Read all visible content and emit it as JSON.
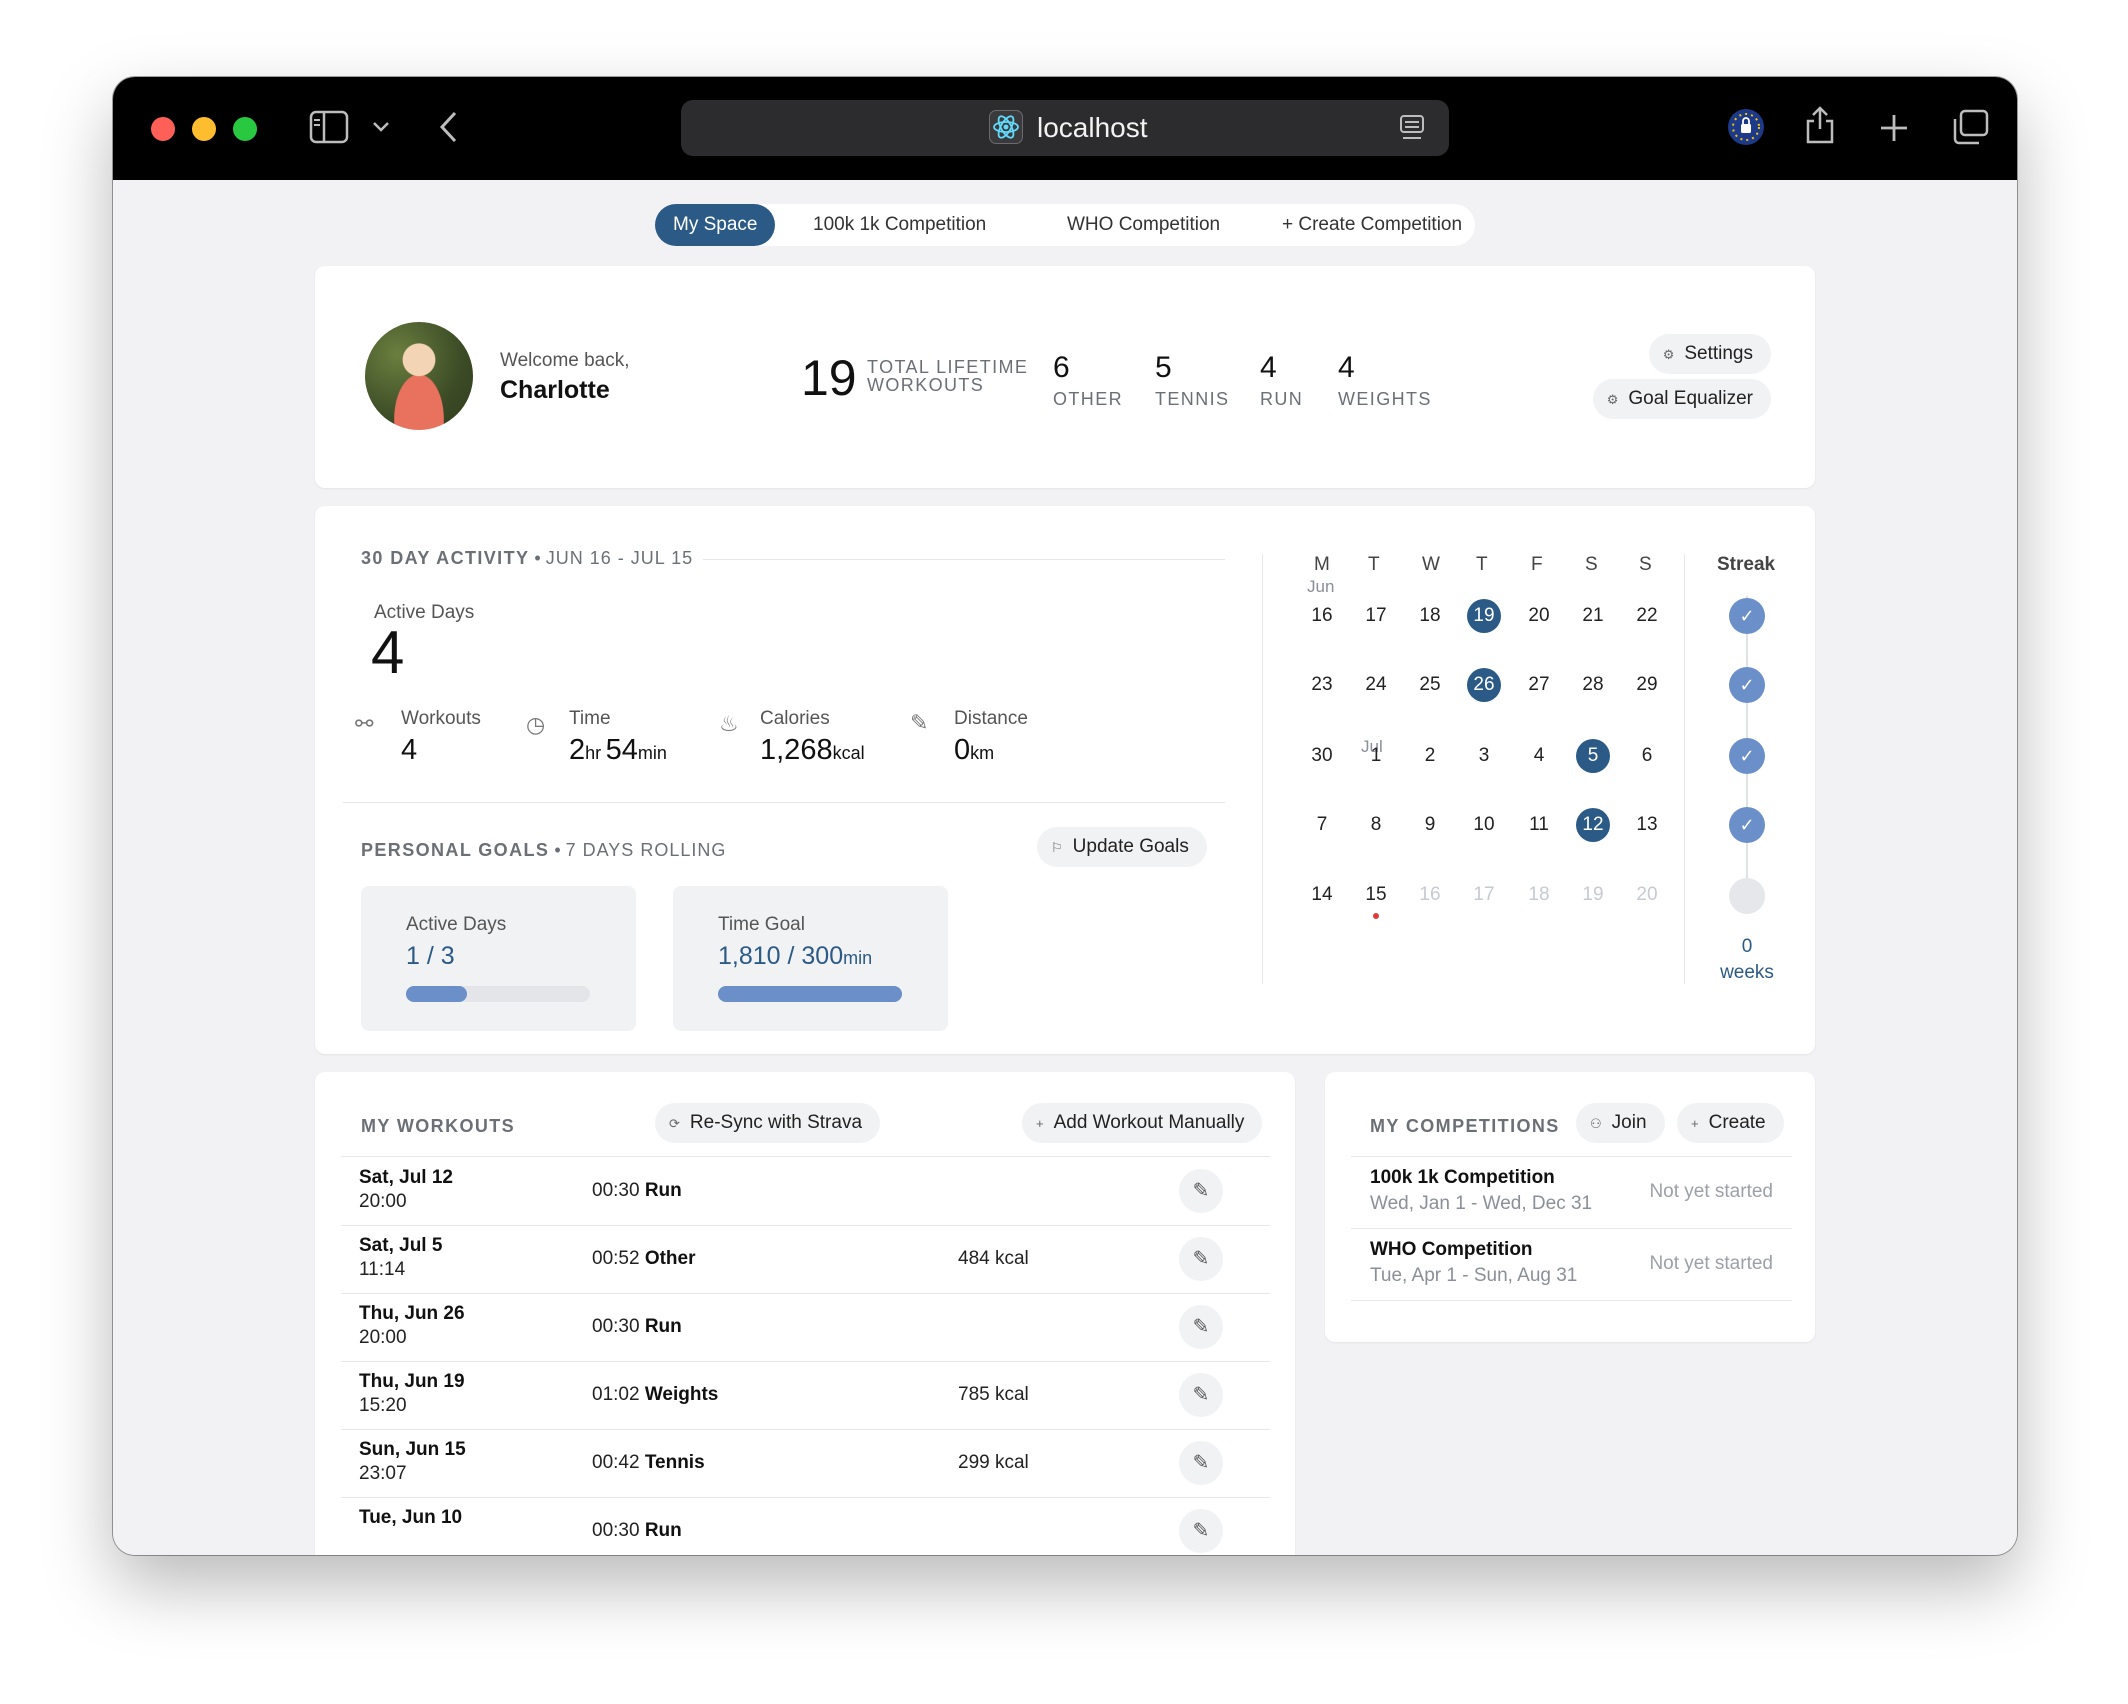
{
  "browser": {
    "url": "localhost"
  },
  "tabs": [
    {
      "label": "My Space",
      "active": true
    },
    {
      "label": "100k 1k Competition",
      "active": false
    },
    {
      "label": "WHO Competition",
      "active": false
    },
    {
      "label": "+ Create Competition",
      "active": false
    }
  ],
  "profile": {
    "welcome": "Welcome back,",
    "name": "Charlotte",
    "total_count": "19",
    "total_label_line1": "TOTAL LIFETIME",
    "total_label_line2": "WORKOUTS",
    "stats": [
      {
        "value": "6",
        "label": "OTHER"
      },
      {
        "value": "5",
        "label": "TENNIS"
      },
      {
        "value": "4",
        "label": "RUN"
      },
      {
        "value": "4",
        "label": "WEIGHTS"
      }
    ],
    "settings_label": "Settings",
    "goal_equalizer_label": "Goal Equalizer"
  },
  "activity": {
    "title": "30 DAY ACTIVITY",
    "range": "JUN 16 - JUL 15",
    "active_days_label": "Active Days",
    "active_days_value": "4",
    "metrics": {
      "workouts_label": "Workouts",
      "workouts_value": "4",
      "time_label": "Time",
      "time_hr": "2",
      "time_hr_unit": "hr",
      "time_min": "54",
      "time_min_unit": "min",
      "calories_label": "Calories",
      "calories_value": "1,268",
      "calories_unit": "kcal",
      "distance_label": "Distance",
      "distance_value": "0",
      "distance_unit": "km"
    }
  },
  "goals": {
    "title": "PERSONAL GOALS",
    "subtitle": "7 DAYS ROLLING",
    "update_label": "Update Goals",
    "active_days_label": "Active Days",
    "active_days_value": "1 / 3",
    "active_days_progress": 0.33,
    "time_goal_label": "Time Goal",
    "time_goal_value": "1,810 / 300",
    "time_goal_unit": "min",
    "time_goal_progress": 1.0
  },
  "calendar": {
    "headers": [
      "M",
      "T",
      "W",
      "T",
      "F",
      "S",
      "S"
    ],
    "month_jun": "Jun",
    "month_jul": "Jul",
    "weeks": [
      [
        "16",
        "17",
        "18",
        "19",
        "20",
        "21",
        "22"
      ],
      [
        "23",
        "24",
        "25",
        "26",
        "27",
        "28",
        "29"
      ],
      [
        "30",
        "1",
        "2",
        "3",
        "4",
        "5",
        "6"
      ],
      [
        "7",
        "8",
        "9",
        "10",
        "11",
        "12",
        "13"
      ],
      [
        "14",
        "15",
        "16",
        "17",
        "18",
        "19",
        "20"
      ]
    ],
    "highlighted": [
      "19",
      "26",
      "5",
      "12"
    ],
    "streak_label": "Streak",
    "streak_value": "0",
    "streak_unit": "weeks"
  },
  "workouts": {
    "title": "MY WORKOUTS",
    "resync_label": "Re-Sync with Strava",
    "add_label": "Add Workout Manually",
    "rows": [
      {
        "date": "Sat, Jul 12",
        "time": "20:00",
        "duration": "00:30",
        "type": "Run",
        "kcal": ""
      },
      {
        "date": "Sat, Jul 5",
        "time": "11:14",
        "duration": "00:52",
        "type": "Other",
        "kcal": "484 kcal"
      },
      {
        "date": "Thu, Jun 26",
        "time": "20:00",
        "duration": "00:30",
        "type": "Run",
        "kcal": ""
      },
      {
        "date": "Thu, Jun 19",
        "time": "15:20",
        "duration": "01:02",
        "type": "Weights",
        "kcal": "785 kcal"
      },
      {
        "date": "Sun, Jun 15",
        "time": "23:07",
        "duration": "00:42",
        "type": "Tennis",
        "kcal": "299 kcal"
      },
      {
        "date": "Tue, Jun 10",
        "time": "",
        "duration": "00:30",
        "type": "Run",
        "kcal": ""
      }
    ]
  },
  "competitions": {
    "title": "MY COMPETITIONS",
    "join_label": "Join",
    "create_label": "Create",
    "items": [
      {
        "name": "100k 1k Competition",
        "dates": "Wed, Jan 1 - Wed, Dec 31",
        "status": "Not yet started"
      },
      {
        "name": "WHO Competition",
        "dates": "Tue, Apr 1 - Sun, Aug 31",
        "status": "Not yet started"
      }
    ]
  },
  "colors": {
    "accent": "#2c5a86",
    "streak": "#6b8fc8",
    "progress": "#6b8fc8"
  }
}
